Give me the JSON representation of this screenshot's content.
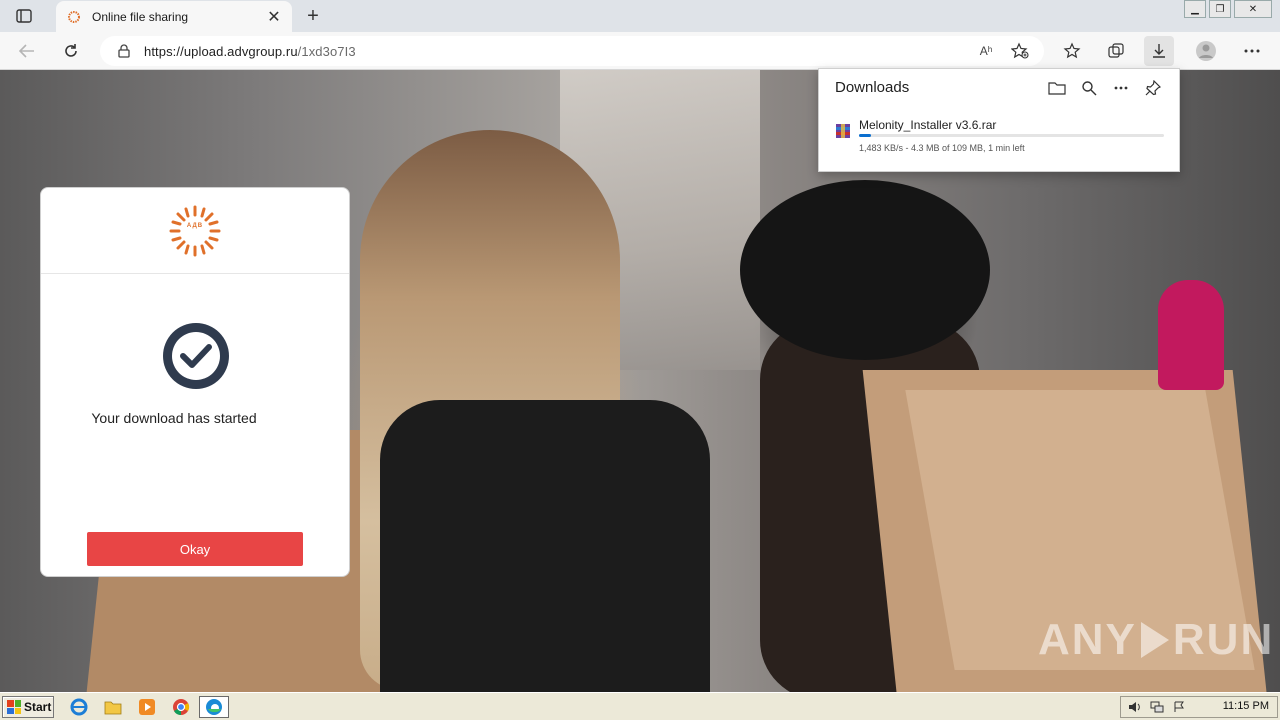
{
  "browser": {
    "tab": {
      "title": "Online file sharing",
      "close": "✕"
    },
    "new_tab": "+",
    "url_host": "https://upload.advgroup.ru",
    "url_path": "/1xd3o7I3",
    "window_controls": [
      "▁",
      "❐",
      "✕"
    ],
    "read_aloud": "Aʰ"
  },
  "dialog": {
    "logo_text": "АДВ",
    "status": "Your download has started",
    "okay_label": "Okay"
  },
  "downloads": {
    "title": "Downloads",
    "file_name": "Melonity_Installer v3.6.rar",
    "meta": "1,483 KB/s - 4.3 MB of 109 MB, 1 min left",
    "progress": 0.04
  },
  "watermark": {
    "left": "ANY",
    "right": "RUN"
  },
  "taskbar": {
    "start_label": "Start",
    "clock": "11:15 PM"
  },
  "colors": {
    "okay_button": "#e84545",
    "progress": "#0b6fcf",
    "check_circle": "#2f3b4e",
    "logo": "#e0702a"
  }
}
